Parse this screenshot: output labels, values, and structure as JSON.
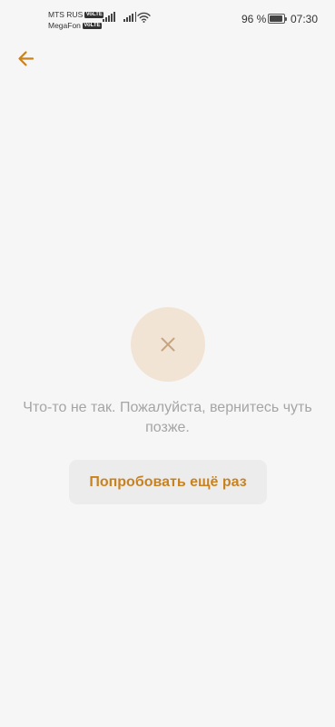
{
  "status_bar": {
    "carrier_1": "MTS RUS",
    "carrier_2": "MegaFon",
    "volte_label": "VoLTE",
    "battery_percent": "96 %",
    "battery_level": 0.96,
    "time": "07:30",
    "icons": [
      "signal-icon",
      "signal-icon",
      "wifi-icon",
      "battery-icon"
    ]
  },
  "header": {
    "back_icon": "arrow-left-icon",
    "accent_color": "#c98220"
  },
  "error": {
    "icon": "close-icon",
    "icon_bg_color": "#f2e4d5",
    "message": "Что-то не так. Пожалуйста, вернитесь чуть позже.",
    "retry_label": "Попробовать ещё раз"
  }
}
